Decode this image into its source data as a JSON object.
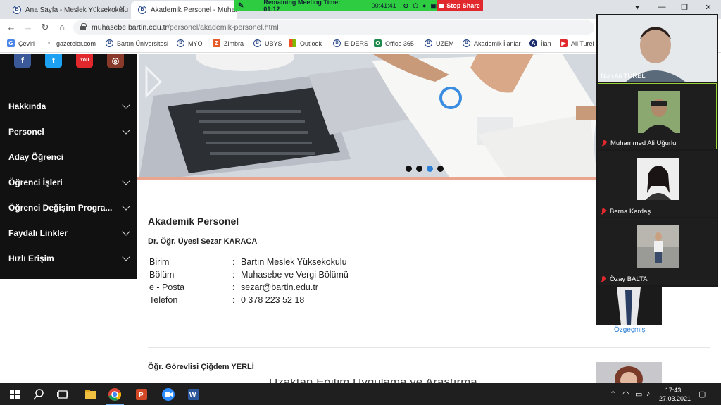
{
  "browser": {
    "tabs": [
      {
        "title": "Ana Sayfa - Meslek Yüksekokulu",
        "active": false
      },
      {
        "title": "Akademik Personel - Muhasebe",
        "active": true
      }
    ],
    "url_host": "muhasebe.bartin.edu.tr",
    "url_path": "/personel/akademik-personel.html",
    "bookmarks": [
      "Çeviri",
      "gazeteler.com",
      "Bartın Üniversitesi",
      "MYO",
      "Zimbra",
      "UBYS",
      "Outlook",
      "E-DERS",
      "Office 365",
      "UZEM",
      "Akademik İlanlar",
      "İlan",
      "Ali Turel"
    ]
  },
  "meeting": {
    "remaining_label": "Remaining Meeting Time: 01:12",
    "elapsed": "00:41:41",
    "stop_share": "Stop Share",
    "participants": [
      {
        "name": "Nuh Ali TUREL",
        "muted": false
      },
      {
        "name": "Muhammed Ali Uğurlu",
        "muted": true
      },
      {
        "name": "Berna Kardaş",
        "muted": true
      },
      {
        "name": "Özay BALTA",
        "muted": true
      }
    ]
  },
  "sidebar": {
    "menu": [
      "Hakkında",
      "Personel",
      "Aday Öğrenci",
      "Öğrenci İşleri",
      "Öğrenci Değişim Progra...",
      "Faydalı Linkler",
      "Hızlı Erişim"
    ]
  },
  "content": {
    "heading": "Akademik Personel",
    "person1": {
      "name": "Dr. Öğr. Üyesi Sezar KARACA",
      "rows": [
        {
          "k": "Birim",
          "v": "Bartın Meslek Yüksekokulu"
        },
        {
          "k": "Bölüm",
          "v": "Muhasebe ve Vergi Bölümü"
        },
        {
          "k": "e - Posta",
          "v": "sezar@bartin.edu.tr"
        },
        {
          "k": "Telefon",
          "v": "0 378 223 52 18"
        }
      ],
      "cv": "Özgeçmiş"
    },
    "person2": {
      "name": "Öğr. Görevlisi Çiğdem YERLİ",
      "partial": "Uzaktan Eğitim Uygulama ve Araştırma Merkezi"
    }
  },
  "taskbar": {
    "time": "17:43",
    "date": "27.03.2021"
  },
  "colors": {
    "meeting_bar": "#2ecc40",
    "stop_share": "#e0282d",
    "active_dot": "#2b7fd6",
    "link": "#2b7fd6"
  }
}
